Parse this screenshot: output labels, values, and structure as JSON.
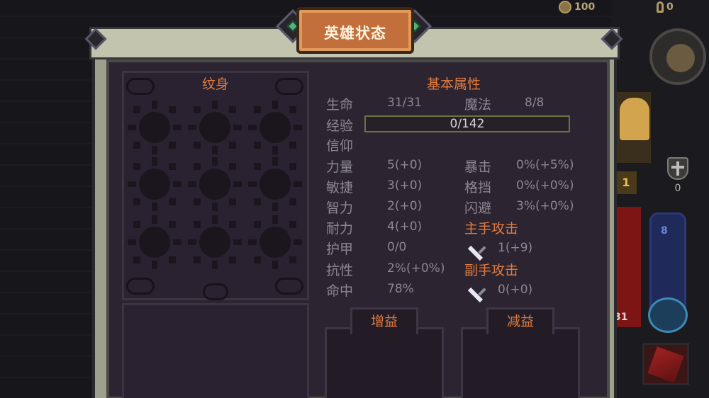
{
  "hud": {
    "coins": "100",
    "keys": "0",
    "shield_count": "0",
    "gold_level": "1",
    "hp_value": "31",
    "mp_value": "8"
  },
  "panel": {
    "title": "英雄状态",
    "tattoo_label": "纹身"
  },
  "stats": {
    "section_title": "基本属性",
    "hp_label": "生命",
    "hp_value": "31/31",
    "mp_label": "魔法",
    "mp_value": "8/8",
    "exp_label": "经验",
    "exp_value": "0/142",
    "exp_progress": 0,
    "faith_label": "信仰",
    "strength_label": "力量",
    "strength_value": "5(+0)",
    "crit_label": "暴击",
    "crit_value": "0%(+5%)",
    "agility_label": "敏捷",
    "agility_value": "3(+0)",
    "block_label": "格挡",
    "block_value": "0%(+0%)",
    "intellect_label": "智力",
    "intellect_value": "2(+0)",
    "dodge_label": "闪避",
    "dodge_value": "3%(+0%)",
    "stamina_label": "耐力",
    "stamina_value": "4(+0)",
    "mainhand_title": "主手攻击",
    "armor_label": "护甲",
    "armor_value": "0/0",
    "mainhand_value": "1(+9)",
    "resist_label": "抗性",
    "resist_value": "2%(+0%)",
    "offhand_title": "副手攻击",
    "hit_label": "命中",
    "hit_value": "78%",
    "offhand_value": "0(+0)"
  },
  "effects": {
    "buff_label": "增益",
    "debuff_label": "减益"
  },
  "colors": {
    "accent_orange": "#e27b3e",
    "label_gray": "#8c8693",
    "panel_bg": "#2c2430",
    "title_plate": "#c26f3c"
  }
}
